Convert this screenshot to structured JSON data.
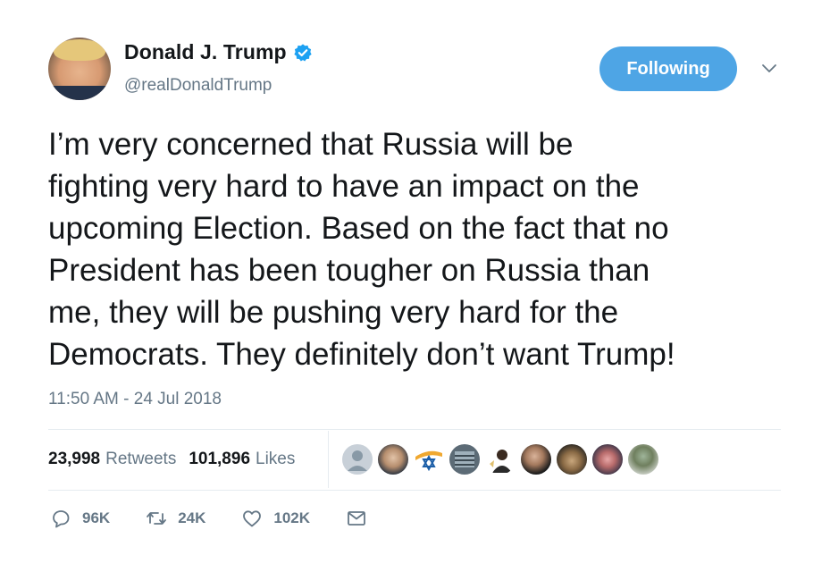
{
  "author": {
    "display_name": "Donald J. Trump",
    "handle": "@realDonaldTrump",
    "verified": true
  },
  "follow_button": {
    "label": "Following"
  },
  "tweet": {
    "text_lines": [
      "I’m very concerned that Russia will be",
      "fighting very hard to have an impact on the",
      "upcoming Election. Based on the fact that no",
      "President has been tougher on Russia than",
      "me, they will be pushing very hard for the",
      "Democrats. They definitely don’t want Trump!"
    ],
    "timestamp": "11:50 AM - 24 Jul 2018"
  },
  "stats": {
    "retweets_count": "23,998",
    "retweets_label": "Retweets",
    "likes_count": "101,896",
    "likes_label": "Likes"
  },
  "actions": {
    "replies": "96K",
    "retweets": "24K",
    "likes": "102K"
  },
  "colors": {
    "accent": "#4ea5e5",
    "secondary_text": "#657786",
    "primary_text": "#14171a",
    "divider": "#e6ecf0"
  },
  "icons": {
    "verified": "verified-badge-icon",
    "caret": "chevron-down-icon",
    "reply": "reply-icon",
    "retweet": "retweet-icon",
    "like": "heart-icon",
    "dm": "envelope-icon"
  }
}
